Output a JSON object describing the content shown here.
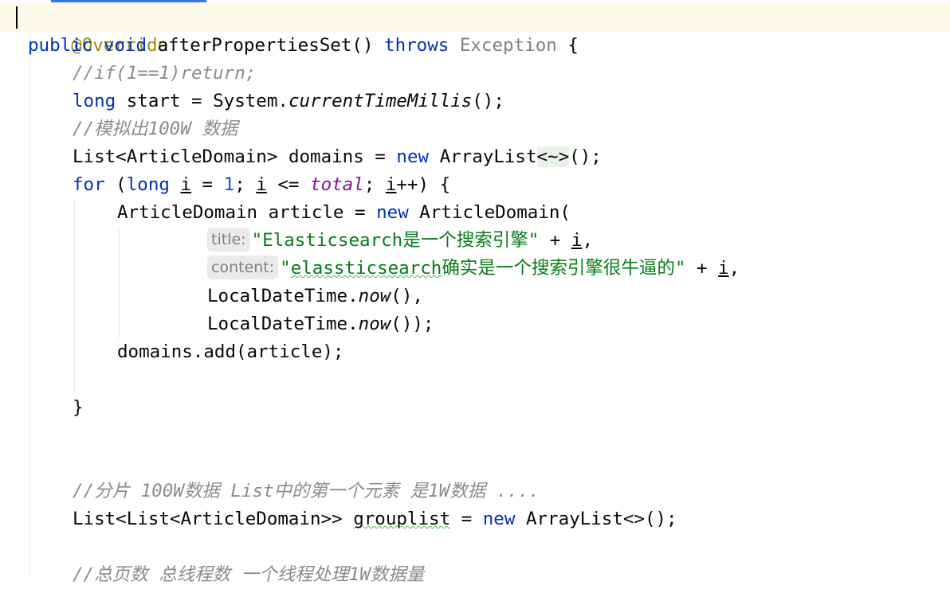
{
  "editor": {
    "l1": {
      "ann": "@Override"
    },
    "l2": {
      "kw1": "public",
      "kw2": "void",
      "name": "afterPropertiesSet()",
      "kw3": "throws",
      "type": "Exception",
      "rest": " {"
    },
    "l3": {
      "comment": "//if(1==1)return;"
    },
    "l4": {
      "kw": "long",
      "a": " start = System.",
      "call": "currentTimeMillis",
      "b": "();"
    },
    "l5": {
      "comment": "//模拟出100W 数据"
    },
    "l6": {
      "a": "List<ArticleDomain> ",
      "b": "domains",
      "c": " = ",
      "kw": "new",
      "d": " ArrayList",
      "diamond": "<~>",
      "e": "();"
    },
    "l7": {
      "kw1": "for",
      "a": " (",
      "kw2": "long",
      "sp": " ",
      "i1": "i",
      "b": " = ",
      "n1": "1",
      "c": "; ",
      "i2": "i",
      "d": " <= ",
      "f": "total",
      "e": "; ",
      "i3": "i",
      "g": "++) {"
    },
    "l8": {
      "a": "ArticleDomain article = ",
      "kw": "new",
      "b": " ArticleDomain("
    },
    "l9": {
      "hint": "title:",
      "str": "\"Elasticsearch是一个搜索引擎\"",
      "a": " + ",
      "i": "i",
      "b": ","
    },
    "l10": {
      "hint": "content:",
      "q": "\"",
      "sq": "elassticsearch",
      "str": "确实是一个搜索引擎很牛逼的\"",
      "a": " + ",
      "i": "i",
      "b": ","
    },
    "l11": {
      "a": "LocalDateTime.",
      "call": "now",
      "b": "(),"
    },
    "l12": {
      "a": "LocalDateTime.",
      "call": "now",
      "b": "());"
    },
    "l13": {
      "text": "domains.add(article);"
    },
    "l15": {
      "text": "}"
    },
    "l18": {
      "comment": "//分片 100W数据 List中的第一个元素 是1W数据 ...."
    },
    "l19": {
      "a": "List<List<ArticleDomain>> ",
      "b": "grouplist",
      "c": " = ",
      "kw": "new",
      "d": " ArrayList<>();"
    },
    "l21": {
      "comment": "//总页数 总线程数 一个线程处理1W数据量"
    }
  }
}
